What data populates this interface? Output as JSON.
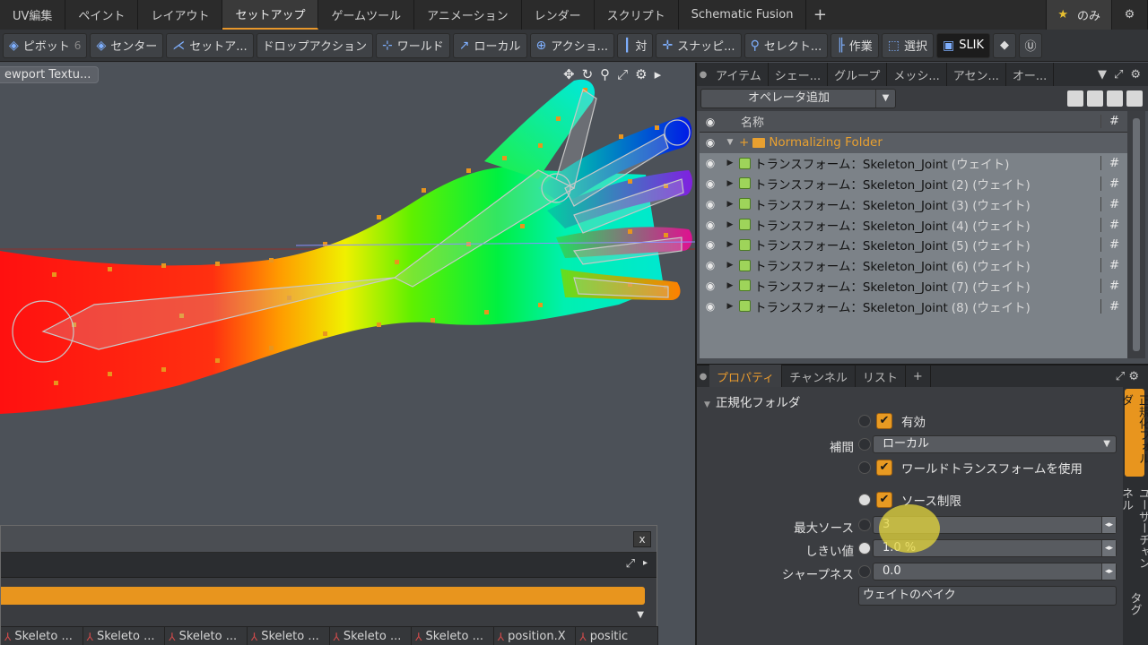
{
  "tabs": [
    "UV編集",
    "ペイント",
    "レイアウト",
    "セットアップ",
    "ゲームツール",
    "アニメーション",
    "レンダー",
    "スクリプト",
    "Schematic Fusion"
  ],
  "active_tab": "セットアップ",
  "tab_add": "+",
  "favorites": {
    "star": "★",
    "label": "のみ"
  },
  "gear": "⚙",
  "toolbar": [
    {
      "icon": "pivot-icon",
      "glyph": "◈",
      "label": "ピボット",
      "num": "6"
    },
    {
      "icon": "center-icon",
      "glyph": "◈",
      "label": "センター",
      "num": ""
    },
    {
      "icon": "setup-icon",
      "glyph": "⋌",
      "label": "セットア...",
      "num": ""
    },
    {
      "icon": "",
      "glyph": "",
      "label": "ドロップアクション",
      "num": ""
    },
    {
      "icon": "world-icon",
      "glyph": "⊹",
      "label": "ワールド",
      "num": ""
    },
    {
      "icon": "local-icon",
      "glyph": "↗",
      "label": "ローカル",
      "num": ""
    },
    {
      "icon": "action-icon",
      "glyph": "⊕",
      "label": "アクショ...",
      "num": ""
    },
    {
      "icon": "symmetry-icon",
      "glyph": "┃",
      "label": "対",
      "num": ""
    },
    {
      "icon": "snap-icon",
      "glyph": "✛",
      "label": "スナッピ...",
      "num": ""
    },
    {
      "icon": "select-icon",
      "glyph": "⚲",
      "label": "セレクト...",
      "num": ""
    },
    {
      "icon": "work-icon",
      "glyph": "╟",
      "label": "作業",
      "num": ""
    },
    {
      "icon": "choose-icon",
      "glyph": "⬚",
      "label": "選択",
      "num": ""
    },
    {
      "icon": "slik-icon",
      "glyph": "▣",
      "label": "SLIK",
      "num": ""
    }
  ],
  "viewport": {
    "label": "ewport Textu...",
    "icons": [
      "✥",
      "↻",
      "⚲",
      "⤢",
      "⚙",
      "▸"
    ]
  },
  "graph_panel": {
    "close": "x",
    "columns": [
      "Skeleto ...",
      "Skeleto ...",
      "Skeleto ...",
      "Skeleto ...",
      "Skeleto ...",
      "Skeleto ...",
      "position.X",
      "positic"
    ]
  },
  "item_tabs": [
    "アイテム",
    "シェー...",
    "グループ",
    "メッシ...",
    "アセン...",
    "オー..."
  ],
  "operator_button": "オペレータ追加",
  "list": {
    "header_name": "名称",
    "header_hash": "#",
    "folder": "Normalizing Folder",
    "rows": [
      {
        "name": "トランスフォーム：Skeleton_Joint",
        "suffix": "(ウェイト)"
      },
      {
        "name": "トランスフォーム：Skeleton_Joint",
        "suffix": "(2) (ウェイト)"
      },
      {
        "name": "トランスフォーム：Skeleton_Joint",
        "suffix": "(3) (ウェイト)"
      },
      {
        "name": "トランスフォーム：Skeleton_Joint",
        "suffix": "(4) (ウェイト)"
      },
      {
        "name": "トランスフォーム：Skeleton_Joint",
        "suffix": "(5) (ウェイト)"
      },
      {
        "name": "トランスフォーム：Skeleton_Joint",
        "suffix": "(6) (ウェイト)"
      },
      {
        "name": "トランスフォーム：Skeleton_Joint",
        "suffix": "(7) (ウェイト)"
      },
      {
        "name": "トランスフォーム：Skeleton_Joint",
        "suffix": "(8) (ウェイト)"
      }
    ]
  },
  "prop_tabs": [
    "プロパティ",
    "チャンネル",
    "リスト",
    "+"
  ],
  "props": {
    "section": "正規化フォルダ",
    "enabled_label": "有効",
    "interp_label": "補間",
    "interp_value": "ローカル",
    "world_label": "ワールドトランスフォームを使用",
    "source_limit_label": "ソース制限",
    "max_source_label": "最大ソース",
    "max_source_value": "3",
    "threshold_label": "しきい値",
    "threshold_value": "1.0 %",
    "sharpness_label": "シャープネス",
    "sharpness_value": "0.0",
    "bake_button": "ウェイトのベイク"
  },
  "side_tabs": [
    "正規化フォルダ",
    "ユーザーチャンネル",
    "タグ"
  ]
}
